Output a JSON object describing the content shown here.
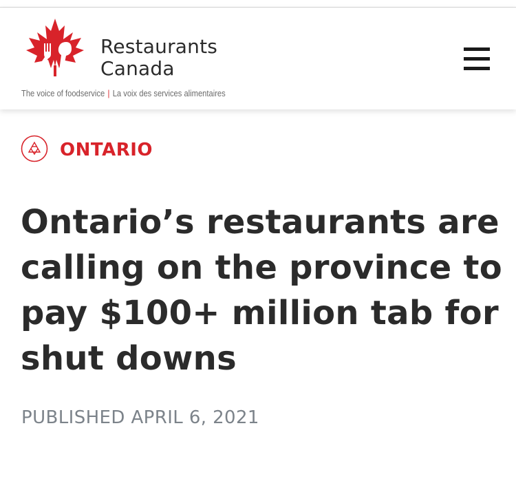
{
  "colors": {
    "brand_red": "#d8232a",
    "headline_text": "#2b2b2b",
    "meta_text": "#7c838a"
  },
  "header": {
    "logo": {
      "name_line1": "Restaurants",
      "name_line2": "Canada",
      "tagline_en": "The voice of foodservice",
      "tagline_separator": "|",
      "tagline_fr": "La voix des services alimentaires",
      "icon": "maple-leaf-fork-knife-logo"
    },
    "menu_icon": "hamburger-menu-icon"
  },
  "article": {
    "category_icon": "region-emblem-icon",
    "category": "ONTARIO",
    "headline_lines": [
      "Ontario’s restaurants are",
      "calling on the province to",
      "pay $100+ million tab for",
      "shut downs"
    ],
    "published": "PUBLISHED APRIL 6, 2021"
  }
}
